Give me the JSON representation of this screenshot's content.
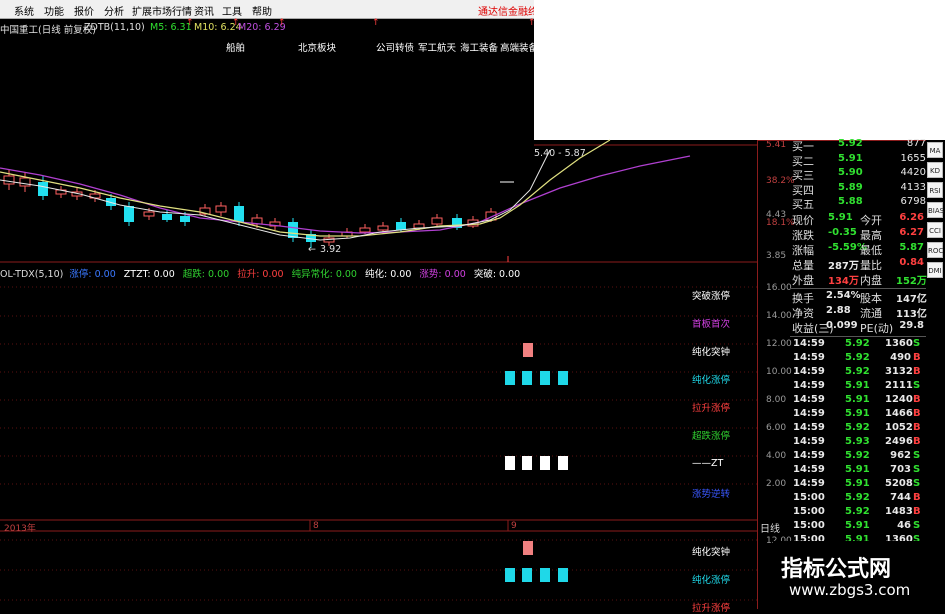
{
  "menu": {
    "items": [
      "系统",
      "功能",
      "报价",
      "分析",
      "扩展市场行情",
      "资讯",
      "工具",
      "帮助"
    ],
    "badge": "通达信金融终"
  },
  "title": {
    "stock": "中国重工(日线 前复权)",
    "formula": "ZDTB(11,10)",
    "ma5": "M5: 6.31",
    "ma10": "M10: 6.24",
    "ma20": "M20: 6.29"
  },
  "concept_tags": [
    "船舶",
    "北京板块",
    "公司转债",
    "军工航天",
    "海工装备",
    "高端装备"
  ],
  "price_annotations": {
    "high": "5.40 - 5.87",
    "low": "3.92"
  },
  "price_axis": [
    "5.41",
    "38.2%",
    "4.43",
    "18.1%",
    "3.85"
  ],
  "indicator_line": {
    "name": "OL-TDX(5,10)",
    "items": [
      "涨停: 0.00",
      "ZTZT: 0.00",
      "超跌: 0.00",
      "拉升: 0.00",
      "纯异常化: 0.00",
      "纯化: 0.00",
      "涨势: 0.00",
      "突破: 0.00"
    ]
  },
  "indicator_legend": [
    "突破涨停",
    "首板首次",
    "纯化突钟",
    "纯化涨停",
    "拉升涨停",
    "超跌涨停",
    "——ZT",
    "涨势逆转"
  ],
  "indicator_axis": [
    "16.00",
    "14.00",
    "12.00",
    "10.00",
    "8.00",
    "6.00",
    "4.00",
    "2.00"
  ],
  "date_axis": {
    "year": "2013年",
    "m1": "8",
    "m2": "9"
  },
  "quote_panel": {
    "bids": [
      {
        "label": "买一",
        "price": "5.92",
        "vol": "877"
      },
      {
        "label": "买二",
        "price": "5.91",
        "vol": "1655"
      },
      {
        "label": "买三",
        "price": "5.90",
        "vol": "4420"
      },
      {
        "label": "买四",
        "price": "5.89",
        "vol": "4133"
      },
      {
        "label": "买五",
        "price": "5.88",
        "vol": "6798"
      }
    ],
    "stats": [
      {
        "l1": "现价",
        "v1": "5.91",
        "l2": "今开",
        "v2": "6.26"
      },
      {
        "l1": "涨跌",
        "v1": "-0.35",
        "l2": "最高",
        "v2": "6.27"
      },
      {
        "l1": "涨幅",
        "v1": "-5.59%",
        "l2": "最低",
        "v2": "5.87"
      },
      {
        "l1": "总量",
        "v1": "287万",
        "l2": "量比",
        "v2": "0.84"
      },
      {
        "l1": "外盘",
        "v1": "134万",
        "l2": "内盘",
        "v2": "152万"
      }
    ],
    "stats2": [
      {
        "l1": "换手",
        "v1": "2.54%",
        "l2": "股本",
        "v2": "147亿"
      },
      {
        "l1": "净资",
        "v1": "2.88",
        "l2": "流通",
        "v2": "113亿"
      },
      {
        "l1": "收益(三)",
        "v1": "0.099",
        "l2": "PE(动)",
        "v2": "29.8"
      }
    ]
  },
  "ticks": [
    {
      "t": "14:59",
      "p": "5.92",
      "v": "1360",
      "d": "S"
    },
    {
      "t": "14:59",
      "p": "5.92",
      "v": "490",
      "d": "B"
    },
    {
      "t": "14:59",
      "p": "5.92",
      "v": "3132",
      "d": "B"
    },
    {
      "t": "14:59",
      "p": "5.91",
      "v": "2111",
      "d": "S"
    },
    {
      "t": "14:59",
      "p": "5.91",
      "v": "1240",
      "d": "B"
    },
    {
      "t": "14:59",
      "p": "5.91",
      "v": "1466",
      "d": "B"
    },
    {
      "t": "14:59",
      "p": "5.92",
      "v": "1052",
      "d": "B"
    },
    {
      "t": "14:59",
      "p": "5.93",
      "v": "2496",
      "d": "B"
    },
    {
      "t": "14:59",
      "p": "5.92",
      "v": "962",
      "d": "S"
    },
    {
      "t": "14:59",
      "p": "5.91",
      "v": "703",
      "d": "S"
    },
    {
      "t": "14:59",
      "p": "5.91",
      "v": "5208",
      "d": "S"
    },
    {
      "t": "15:00",
      "p": "5.92",
      "v": "744",
      "d": "B"
    },
    {
      "t": "15:00",
      "p": "5.92",
      "v": "1483",
      "d": "B"
    },
    {
      "t": "15:00",
      "p": "5.91",
      "v": "46",
      "d": "S"
    },
    {
      "t": "15:00",
      "p": "5.91",
      "v": "1360",
      "d": "S"
    }
  ],
  "lower_panel": {
    "period": "日线",
    "axis": "12.00",
    "legend": [
      "纯化突钟",
      "纯化涨停",
      "拉升涨停"
    ]
  },
  "side_tabs": [
    "MA",
    "KD",
    "RSI",
    "BIAS",
    "CCI",
    "ROC",
    "DMI"
  ],
  "watermark": {
    "cn": "指标公式网",
    "url": "www.zbgs3.com"
  },
  "colors": {
    "up": "#ff4040",
    "down": "#22e0f0",
    "ma_purple": "#b040d0",
    "ma_yellow": "#e0e080",
    "frame": "#8b1c1c"
  }
}
